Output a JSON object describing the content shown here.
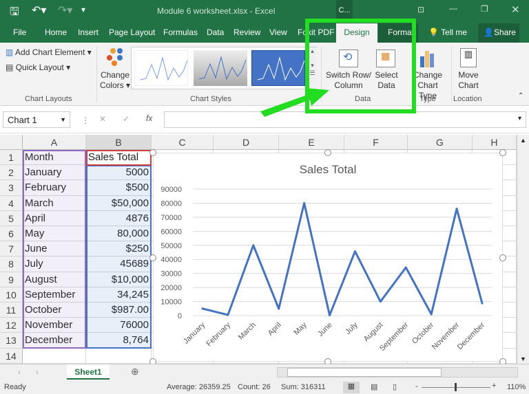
{
  "title": {
    "doc": "Module 6 worksheet.xlsx  -  Excel",
    "context": "C..."
  },
  "tabs": [
    "File",
    "Home",
    "Insert",
    "Page Layout",
    "Formulas",
    "Data",
    "Review",
    "View",
    "Foxit PDF",
    "Design",
    "Format",
    "Tell me",
    "Share"
  ],
  "ribbon": {
    "add_chart_element": "Add Chart Element",
    "quick_layout": "Quick Layout",
    "change_colors_1": "Change",
    "change_colors_2": "Colors",
    "switch_1": "Switch Row/",
    "switch_2": "Column",
    "select_1": "Select",
    "select_2": "Data",
    "change_type_1": "Change",
    "change_type_2": "Chart Type",
    "move_1": "Move",
    "move_2": "Chart",
    "groups": {
      "layouts": "Chart Layouts",
      "styles": "Chart Styles",
      "data": "Data",
      "type": "Type",
      "location": "Location"
    }
  },
  "name_box": "Chart 1",
  "formula_icons": {
    "cancel": "✕",
    "enter": "✓",
    "fx": "fx"
  },
  "columns": [
    "A",
    "B",
    "C",
    "D",
    "E",
    "F",
    "G",
    "H"
  ],
  "rows": [
    [
      "Month",
      "Sales Total"
    ],
    [
      "January",
      "5000"
    ],
    [
      "February",
      "$500"
    ],
    [
      "March",
      "$50,000"
    ],
    [
      "April",
      "4876"
    ],
    [
      "May",
      "80,000"
    ],
    [
      "June",
      "$250"
    ],
    [
      "July",
      "45689"
    ],
    [
      "August",
      "$10,000"
    ],
    [
      "September",
      "34,245"
    ],
    [
      "October",
      "$987.00"
    ],
    [
      "November",
      "76000"
    ],
    [
      "December",
      "8,764"
    ],
    [
      "",
      ""
    ]
  ],
  "chart_data": {
    "type": "line",
    "title": "Sales Total",
    "categories": [
      "January",
      "February",
      "March",
      "April",
      "May",
      "June",
      "July",
      "August",
      "September",
      "October",
      "November",
      "December"
    ],
    "values": [
      5000,
      500,
      50000,
      4876,
      80000,
      250,
      45689,
      10000,
      34245,
      987,
      76000,
      8764
    ],
    "ylim": [
      0,
      90000
    ],
    "yticks": [
      "0",
      "10000",
      "20000",
      "30000",
      "40000",
      "50000",
      "60000",
      "70000",
      "80000",
      "90000"
    ],
    "grid": true,
    "color": "#4472c4"
  },
  "sheet_tab": "Sheet1",
  "status": {
    "ready": "Ready",
    "average": "Average: 26359.25",
    "count": "Count: 26",
    "sum": "Sum: 316311",
    "zoom": "110%"
  },
  "highlight_color": "#22dd22"
}
